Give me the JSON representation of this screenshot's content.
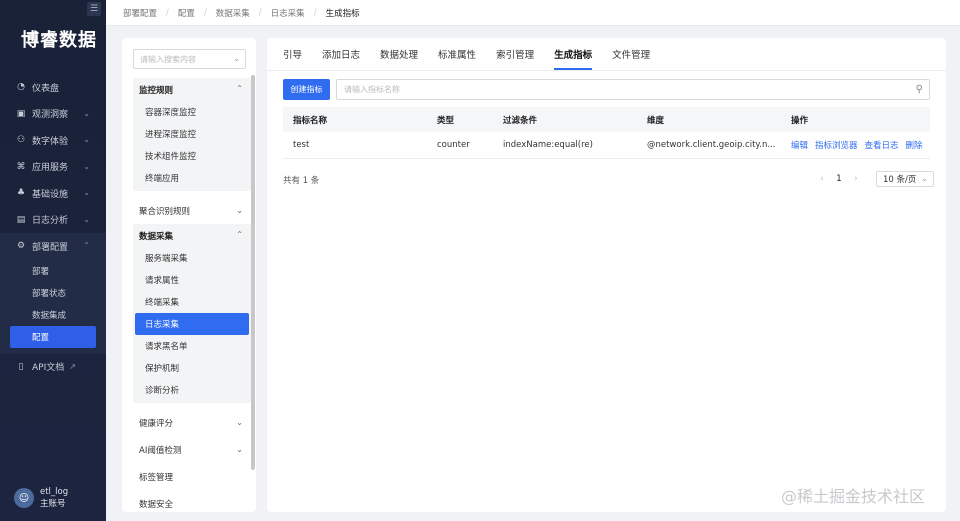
{
  "sidebar": {
    "brand": "博睿数据",
    "collapse_icon": "menu-fold-icon",
    "items": [
      {
        "label": "仪表盘",
        "icon": "dashboard-icon",
        "chev": ""
      },
      {
        "label": "观测洞察",
        "icon": "observe-icon",
        "chev": "⌄"
      },
      {
        "label": "数字体验",
        "icon": "user-experience-icon",
        "chev": "⌄"
      },
      {
        "label": "应用服务",
        "icon": "app-service-icon",
        "chev": "⌄"
      },
      {
        "label": "基础设施",
        "icon": "infra-icon",
        "chev": "⌄"
      },
      {
        "label": "日志分析",
        "icon": "log-icon",
        "chev": "⌄"
      },
      {
        "label": "部署配置",
        "icon": "deploy-icon",
        "chev": "⌃"
      }
    ],
    "sub_items": [
      "部署",
      "部署状态",
      "数据集成",
      "配置"
    ],
    "api_doc": "API文档",
    "user": {
      "name": "etl_log",
      "role": "主账号"
    }
  },
  "breadcrumb": [
    "部署配置",
    "配置",
    "数据采集",
    "日志采集",
    "生成指标"
  ],
  "panel": {
    "search_placeholder": "请输入搜索内容",
    "groups": [
      {
        "title": "监控规则",
        "children": [
          "容器深度监控",
          "进程深度监控",
          "技术组件监控",
          "终端应用"
        ]
      },
      {
        "title": "聚合识别规则",
        "children": []
      },
      {
        "title": "数据采集",
        "children": [
          "服务端采集",
          "请求属性",
          "终端采集",
          "日志采集",
          "请求黑名单",
          "保护机制",
          "诊断分析"
        ]
      }
    ],
    "other": [
      "健康评分",
      "AI阈值检测",
      "标签管理",
      "数据安全"
    ]
  },
  "tabs": [
    "引导",
    "添加日志",
    "数据处理",
    "标准属性",
    "索引管理",
    "生成指标",
    "文件管理"
  ],
  "active_tab": "生成指标",
  "toolbar": {
    "create_label": "创建指标",
    "name_placeholder": "请输入指标名称"
  },
  "table": {
    "headers": [
      "指标名称",
      "类型",
      "过滤条件",
      "维度",
      "操作"
    ],
    "rows": [
      {
        "name": "test",
        "type": "counter",
        "filter": "indexName:equal(re)",
        "dimension": "@network.client.geoip.city.n...",
        "ops": [
          "编辑",
          "指标浏览器",
          "查看日志",
          "删除"
        ]
      }
    ]
  },
  "pagination": {
    "total": "共有 1 条",
    "prev": "‹",
    "page": "1",
    "next": "›",
    "size": "10 条/页"
  },
  "watermark": "@稀土掘金技术社区",
  "colors": {
    "accent": "#2f6cf0",
    "sidebar": "#1a2238"
  }
}
